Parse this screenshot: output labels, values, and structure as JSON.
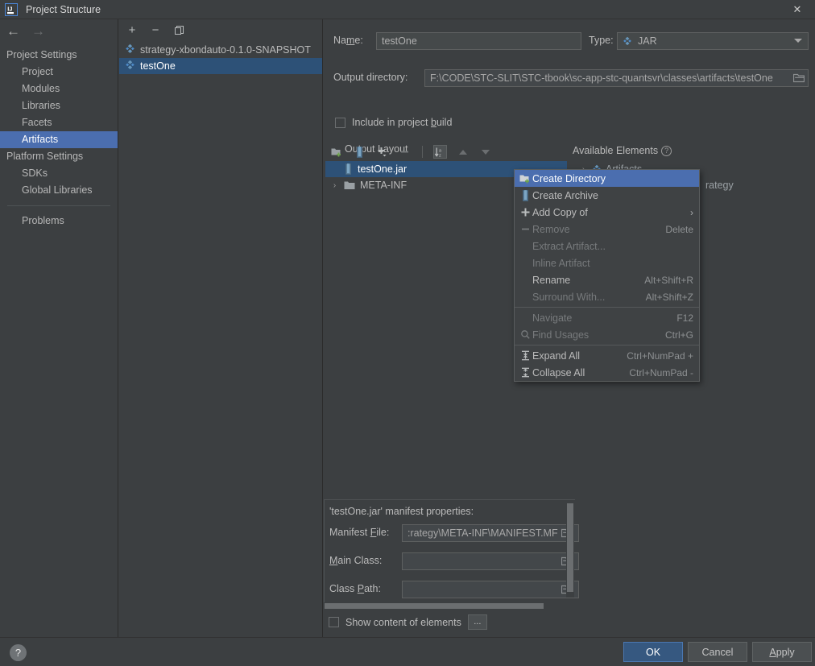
{
  "window": {
    "title": "Project Structure",
    "logo_icon": "intellij-idea-logo",
    "close_icon": "✕"
  },
  "nav": {
    "back_icon": "←",
    "forward_icon": "→"
  },
  "sidebar": {
    "groups": [
      {
        "label": "Project Settings",
        "items": [
          {
            "label": "Project",
            "selected": false
          },
          {
            "label": "Modules",
            "selected": false
          },
          {
            "label": "Libraries",
            "selected": false
          },
          {
            "label": "Facets",
            "selected": false
          },
          {
            "label": "Artifacts",
            "selected": true
          }
        ]
      },
      {
        "label": "Platform Settings",
        "items": [
          {
            "label": "SDKs",
            "selected": false
          },
          {
            "label": "Global Libraries",
            "selected": false
          }
        ]
      }
    ],
    "problems_label": "Problems"
  },
  "artifacts_panel": {
    "toolbar": [
      {
        "name": "add-artifact-button",
        "glyph": "+"
      },
      {
        "name": "remove-artifact-button",
        "glyph": "−"
      },
      {
        "name": "copy-artifact-button",
        "glyph": "▤"
      }
    ],
    "items": [
      {
        "label": "strategy-xbondauto-0.1.0-SNAPSHOT",
        "selected": false
      },
      {
        "label": "testOne",
        "selected": true
      }
    ]
  },
  "detail": {
    "name_label": "Name:",
    "name_value": "testOne",
    "type_label": "Type:",
    "type_value": "JAR",
    "output_dir_label": "Output directory:",
    "output_dir_value": "F:\\CODE\\STC-SLIT\\STC-tbook\\sc-app-stc-quantsvr\\classes\\artifacts\\testOne",
    "include_in_build_label": "Include in project build",
    "include_in_build_checked": false,
    "output_layout_label": "Output Layout"
  },
  "layout_toolbar": {
    "buttons": [
      {
        "name": "create-directory-button",
        "glyph": "▣",
        "enabled": true
      },
      {
        "name": "create-archive-button",
        "glyph": "▥",
        "enabled": true
      },
      {
        "name": "add-copy-button",
        "glyph": "+",
        "enabled": true
      },
      {
        "name": "remove-element-button",
        "glyph": "−",
        "enabled": false
      },
      {
        "name": "sort-alphabetically-button",
        "glyph": "↓",
        "enabled": true,
        "pressed": true
      },
      {
        "name": "move-up-button",
        "glyph": "▲",
        "enabled": false
      },
      {
        "name": "move-down-button",
        "glyph": "▼",
        "enabled": false
      }
    ]
  },
  "layout_tree": {
    "rows": [
      {
        "label": "testOne.jar",
        "icon": "archive-icon",
        "selected": true,
        "twisty": ""
      },
      {
        "label": "META-INF",
        "icon": "folder-icon",
        "selected": false,
        "twisty": "›"
      }
    ]
  },
  "available_elements": {
    "title": "Available Elements",
    "help_glyph": "?",
    "rows": [
      {
        "label": "Artifacts",
        "twisty": "›"
      },
      {
        "label": "rategy",
        "twisty": ""
      }
    ]
  },
  "context_menu": {
    "items": [
      {
        "label": "Create Directory",
        "accel": "",
        "icon": "create-directory-icon",
        "enabled": true,
        "selected": true,
        "submenu": false
      },
      {
        "label": "Create Archive",
        "accel": "",
        "icon": "create-archive-icon",
        "enabled": true,
        "selected": false,
        "submenu": false
      },
      {
        "label": "Add Copy of",
        "accel": "",
        "icon": "plus-icon",
        "enabled": true,
        "selected": false,
        "submenu": true
      },
      {
        "label": "Remove",
        "accel": "Delete",
        "icon": "minus-icon",
        "enabled": false,
        "selected": false,
        "submenu": false
      },
      {
        "label": "Extract Artifact...",
        "accel": "",
        "icon": "",
        "enabled": false,
        "selected": false,
        "submenu": false
      },
      {
        "label": "Inline Artifact",
        "accel": "",
        "icon": "",
        "enabled": false,
        "selected": false,
        "submenu": false
      },
      {
        "label": "Rename",
        "accel": "Alt+Shift+R",
        "icon": "",
        "enabled": true,
        "selected": false,
        "submenu": false
      },
      {
        "label": "Surround With...",
        "accel": "Alt+Shift+Z",
        "icon": "",
        "enabled": false,
        "selected": false,
        "submenu": false
      },
      {
        "separator": true
      },
      {
        "label": "Navigate",
        "accel": "F12",
        "icon": "",
        "enabled": false,
        "selected": false,
        "submenu": false
      },
      {
        "label": "Find Usages",
        "accel": "Ctrl+G",
        "icon": "search-icon",
        "enabled": false,
        "selected": false,
        "submenu": false
      },
      {
        "separator": true
      },
      {
        "label": "Expand All",
        "accel": "Ctrl+NumPad +",
        "icon": "expand-all-icon",
        "enabled": true,
        "selected": false,
        "submenu": false
      },
      {
        "label": "Collapse All",
        "accel": "Ctrl+NumPad -",
        "icon": "collapse-all-icon",
        "enabled": true,
        "selected": false,
        "submenu": false
      }
    ],
    "submenu_arrow": "›"
  },
  "manifest": {
    "title": "'testOne.jar' manifest properties:",
    "rows": [
      {
        "label": "Manifest File:",
        "value": ":rategy\\META-INF\\MANIFEST.MF"
      },
      {
        "label": "Main Class:",
        "value": ""
      },
      {
        "label": "Class Path:",
        "value": ""
      }
    ]
  },
  "show_content": {
    "label": "Show content of elements",
    "checked": false,
    "more_button_label": "..."
  },
  "footer": {
    "help_label": "?",
    "ok_label": "OK",
    "cancel_label": "Cancel",
    "apply_label": "Apply"
  },
  "colors": {
    "background": "#3c3f41",
    "selection_blue": "#4b6eaf",
    "tree_selection": "#2d5177",
    "accent_jar": "#6897bb",
    "primary_button": "#365880"
  }
}
